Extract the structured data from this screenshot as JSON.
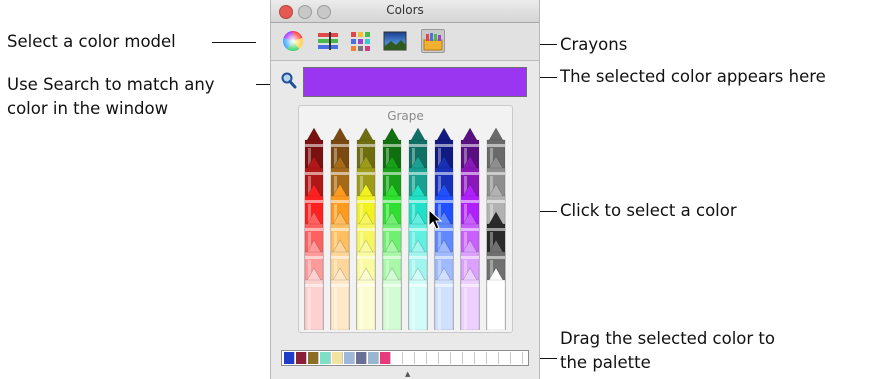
{
  "window": {
    "title": "Colors",
    "selected_color": "#9A35F0",
    "selected_color_name": "Grape",
    "toolbar": [
      "color-wheel-icon",
      "color-sliders-icon",
      "color-palettes-icon",
      "image-palettes-icon",
      "crayons-icon"
    ],
    "palette_colors": [
      "#1f3cc9",
      "#8a1f3a",
      "#8b6f27",
      "#7de0c6",
      "#f2e3a3",
      "#9fb8d8",
      "#6a6f96",
      "#9ab5cf",
      "#e83a7b"
    ]
  },
  "callouts": {
    "color_model": "Select a color model",
    "crayons": "Crayons",
    "search_line1": "Use Search to match any",
    "search_line2": "color in the window",
    "selected": "The selected color appears here",
    "click": "Click to select a color",
    "drag_line1": "Drag the selected color to",
    "drag_line2": "the palette"
  }
}
